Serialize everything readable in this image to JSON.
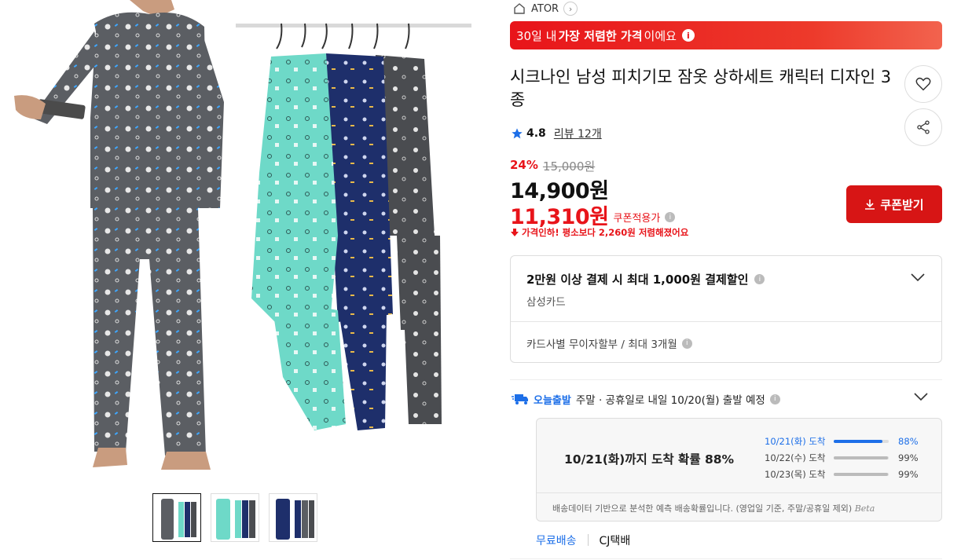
{
  "brand": {
    "name": "ATOR"
  },
  "banner": {
    "prefix": "30일 내 ",
    "bold": "가장 저렴한 가격",
    "suffix": "이에요",
    "info_glyph": "i"
  },
  "product": {
    "title": "시크나인 남성 피치기모 잠옷 상하세트 캐릭터 디자인 3종",
    "rating": "4.8",
    "review_label": "리뷰 12개",
    "discount_rate": "24%",
    "original_price": "15,000원",
    "price": "14,900원",
    "coupon_price": "11,310원",
    "coupon_label": "쿠폰적용가",
    "price_drop_note": "가격인하! 평소보다 2,260원 저렴해졌어요"
  },
  "buttons": {
    "coupon": "쿠폰받기"
  },
  "card_benefit": {
    "title": "2만원 이상 결제 시 최대 1,000원 결제할인",
    "card": "삼성카드",
    "installment": "카드사별 무이자할부 / 최대 3개월"
  },
  "shipping": {
    "tag": "오늘출발",
    "text": "주말 · 공휴일로 내일 10/20(월) 출발 예정",
    "headline": "10/21(화)까지 도착 확률 88%",
    "rows": [
      {
        "date": "10/21(화) 도착",
        "pct": "88%",
        "value": 0.88
      },
      {
        "date": "10/22(수) 도착",
        "pct": "99%",
        "value": 0.99
      },
      {
        "date": "10/23(목) 도착",
        "pct": "99%",
        "value": 0.99
      }
    ],
    "footnote": "배송데이터 기반으로 분석한 예측 배송확률입니다. (영업일 기준, 주말/공휴일 제외)",
    "beta": "Beta",
    "free_label": "무료배송",
    "carrier": "CJ택배"
  },
  "colors": {
    "accent_red": "#e8141a",
    "accent_blue": "#1d6fe8",
    "pajama_gray": "#5b5e63",
    "pajama_mint": "#6ed9c8",
    "pajama_navy": "#1e2f6b"
  }
}
